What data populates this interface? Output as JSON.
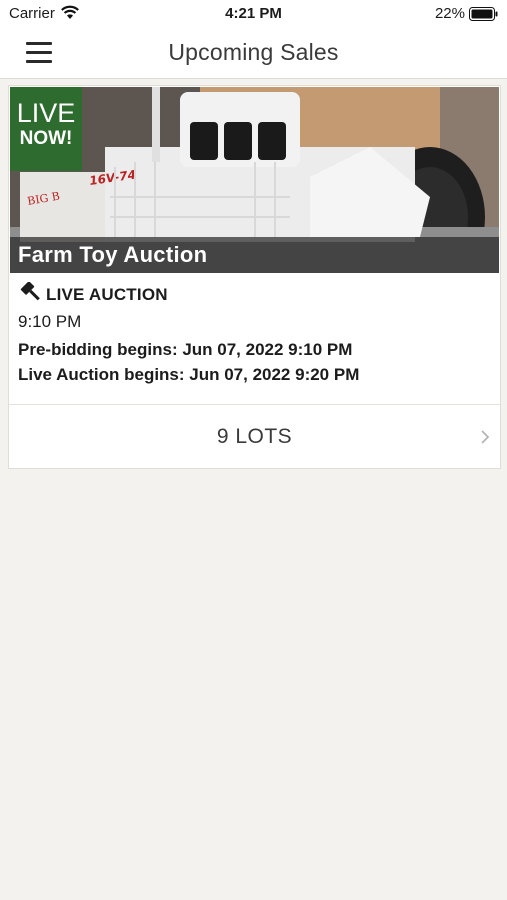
{
  "status_bar": {
    "carrier": "Carrier",
    "time": "4:21 PM",
    "battery_percent": "22%"
  },
  "nav": {
    "title": "Upcoming Sales",
    "menu_icon": "hamburger-menu-icon"
  },
  "sale": {
    "badge_line1": "LIVE",
    "badge_line2": "NOW!",
    "badge_color": "#2e6b2e",
    "title": "Farm Toy Auction",
    "type_icon": "gavel-icon",
    "type_label": "LIVE AUCTION",
    "time": "9:10 PM",
    "prebidding": "Pre-bidding begins: Jun 07, 2022 9:10 PM",
    "live_begins": "Live Auction begins: Jun 07, 2022 9:20 PM",
    "lots_label": "9 LOTS",
    "image_markings": [
      "BIG B",
      "16V-74"
    ]
  }
}
